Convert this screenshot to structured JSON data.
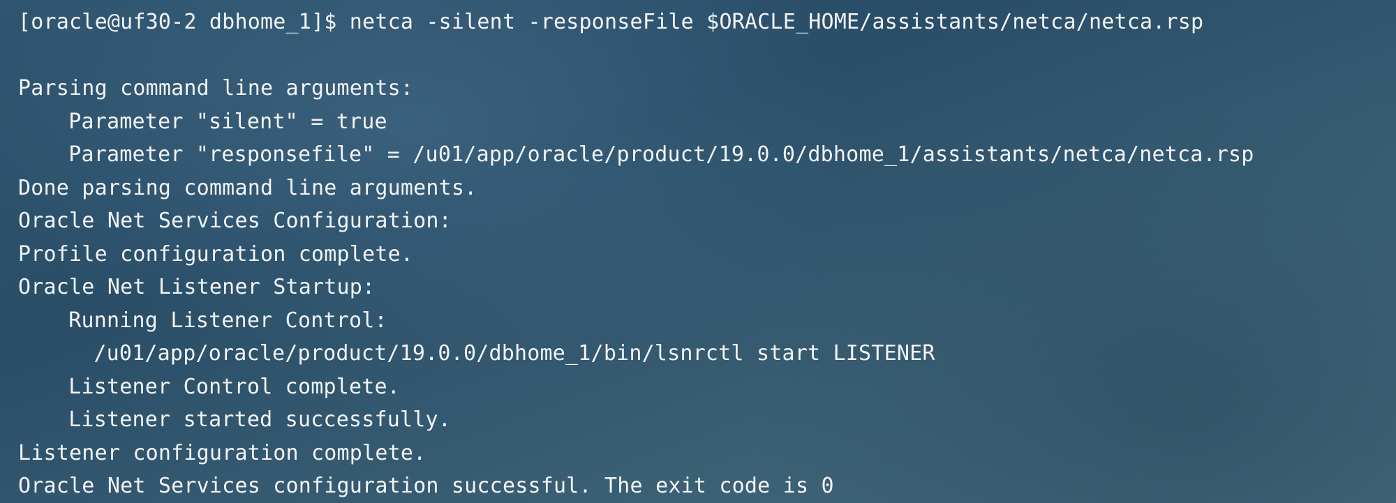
{
  "terminal": {
    "lines": [
      {
        "text": "[oracle@uf30-2 dbhome_1]$ netca -silent -responseFile $ORACLE_HOME/assistants/netca/netca.rsp",
        "indent": 0
      },
      {
        "text": "",
        "indent": 0
      },
      {
        "text": "Parsing command line arguments:",
        "indent": 0
      },
      {
        "text": "Parameter \"silent\" = true",
        "indent": 4
      },
      {
        "text": "Parameter \"responsefile\" = /u01/app/oracle/product/19.0.0/dbhome_1/assistants/netca/netca.rsp",
        "indent": 4
      },
      {
        "text": "Done parsing command line arguments.",
        "indent": 0
      },
      {
        "text": "Oracle Net Services Configuration:",
        "indent": 0
      },
      {
        "text": "Profile configuration complete.",
        "indent": 0
      },
      {
        "text": "Oracle Net Listener Startup:",
        "indent": 0
      },
      {
        "text": "Running Listener Control:",
        "indent": 4
      },
      {
        "text": "/u01/app/oracle/product/19.0.0/dbhome_1/bin/lsnrctl start LISTENER",
        "indent": 6
      },
      {
        "text": "Listener Control complete.",
        "indent": 4
      },
      {
        "text": "Listener started successfully.",
        "indent": 4
      },
      {
        "text": "Listener configuration complete.",
        "indent": 0
      },
      {
        "text": "Oracle Net Services configuration successful. The exit code is 0",
        "indent": 0
      }
    ]
  }
}
